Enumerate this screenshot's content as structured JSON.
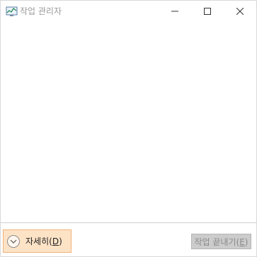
{
  "window": {
    "title": "작업 관리자",
    "controls": {
      "minimize_icon": "minimize-icon",
      "maximize_icon": "maximize-icon",
      "close_icon": "close-icon"
    }
  },
  "footer": {
    "details_button": {
      "label_prefix": "자세히(",
      "label_mnemonic": "D",
      "label_suffix": ")",
      "icon": "chevron-down-icon"
    },
    "end_task_button": {
      "label_prefix": "작업 끝내기(",
      "label_mnemonic": "E",
      "label_suffix": ")",
      "enabled": false
    }
  },
  "colors": {
    "details_bg": "#fde3c6",
    "details_border": "#f0b27a",
    "disabled_bg": "#cccccc",
    "disabled_text": "#8a8a8a"
  }
}
